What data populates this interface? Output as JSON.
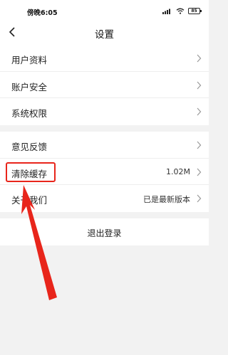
{
  "status_bar": {
    "time": "傍晚6:05",
    "battery": "85",
    "icons": [
      "signal-icon",
      "wifi-icon",
      "battery-icon"
    ]
  },
  "nav": {
    "title": "设置",
    "back_icon": "chevron-left-icon"
  },
  "groups": [
    {
      "items": [
        {
          "label": "用户资料",
          "value": ""
        },
        {
          "label": "账户安全",
          "value": ""
        },
        {
          "label": "系统权限",
          "value": ""
        }
      ]
    },
    {
      "items": [
        {
          "label": "意见反馈",
          "value": ""
        },
        {
          "label": "清除缓存",
          "value": "1.02M"
        },
        {
          "label": "关于我们",
          "value": "已是最新版本"
        }
      ]
    }
  ],
  "logout_label": "退出登录",
  "annotation": {
    "color": "#e8251b",
    "target": "清除缓存"
  }
}
